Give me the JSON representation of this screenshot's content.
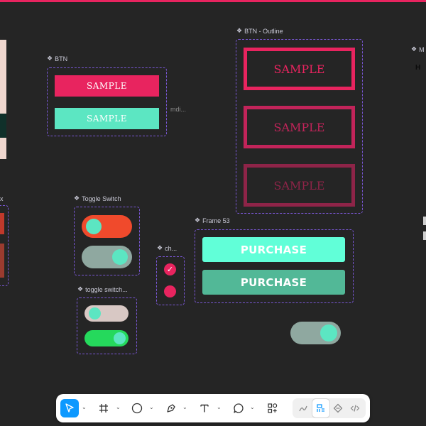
{
  "frames": {
    "btn": {
      "label": "BTN",
      "buttons": [
        "SAMPLE",
        "SAMPLE"
      ],
      "side_note": "mdi..."
    },
    "btn_outline": {
      "label": "BTN - Outline",
      "buttons": [
        "SAMPLE",
        "SAMPLE",
        "SAMPLE"
      ]
    },
    "toggle_switch": {
      "label": "Toggle Switch"
    },
    "toggle_switch_small": {
      "label": "toggle switch..."
    },
    "checkbox": {
      "label": "ch..."
    },
    "frame53": {
      "label": "Frame 53",
      "buttons": [
        "PURCHASE",
        "PURCHASE"
      ]
    },
    "left_partial": {
      "label": "x"
    },
    "right_partial": {
      "label": "M",
      "text": "H"
    }
  },
  "colors": {
    "canvas": "#252525",
    "accent": "#e8245f",
    "mint": "#5ce6c2",
    "frame_border": "#7a57d6"
  },
  "toolbar": {
    "tools": [
      "move-tool",
      "frame-tool",
      "shape-tool",
      "pen-tool",
      "text-tool",
      "comment-tool",
      "actions-tool"
    ],
    "modes": [
      "draw-mode",
      "design-mode",
      "prototype-mode",
      "dev-mode"
    ],
    "active_tool": "move-tool",
    "active_mode": "design-mode"
  }
}
